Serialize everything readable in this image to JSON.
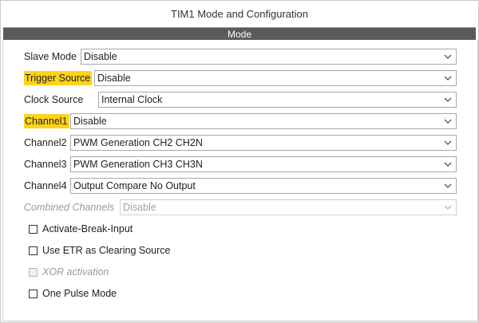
{
  "window": {
    "title": "TIM1 Mode and Configuration"
  },
  "section": {
    "title": "Mode"
  },
  "fields": [
    {
      "label": "Slave Mode",
      "value": "Disable",
      "highlighted": false,
      "disabled": false
    },
    {
      "label": "Trigger Source",
      "value": "Disable",
      "highlighted": true,
      "disabled": false
    },
    {
      "label": "Clock Source",
      "value": "Internal Clock",
      "highlighted": false,
      "disabled": false
    },
    {
      "label": "Channel1",
      "value": "Disable",
      "highlighted": true,
      "disabled": false
    },
    {
      "label": "Channel2",
      "value": "PWM Generation CH2 CH2N",
      "highlighted": false,
      "disabled": false
    },
    {
      "label": "Channel3",
      "value": "PWM Generation CH3 CH3N",
      "highlighted": false,
      "disabled": false
    },
    {
      "label": "Channel4",
      "value": "Output Compare No Output",
      "highlighted": false,
      "disabled": false
    },
    {
      "label": "Combined Channels",
      "value": "Disable",
      "highlighted": false,
      "disabled": true
    }
  ],
  "checkboxes": [
    {
      "label": "Activate-Break-Input",
      "checked": false,
      "disabled": false
    },
    {
      "label": "Use ETR as Clearing Source",
      "checked": false,
      "disabled": false
    },
    {
      "label": "XOR activation",
      "checked": false,
      "disabled": true
    },
    {
      "label": "One Pulse Mode",
      "checked": false,
      "disabled": false
    }
  ],
  "colors": {
    "highlight": "#ffd319",
    "header_bg": "#5b5b5b",
    "disabled_text": "#9a9a9a"
  },
  "icons": {
    "dropdown": "chevron-down-icon"
  }
}
